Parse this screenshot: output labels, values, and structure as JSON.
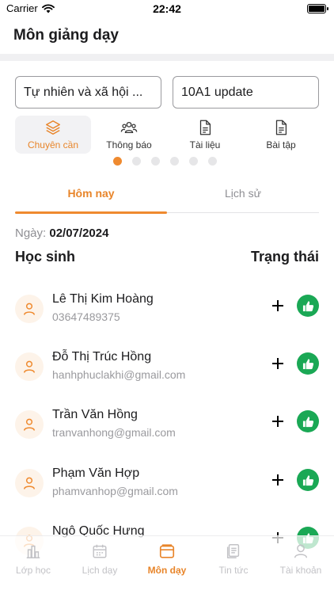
{
  "status_bar": {
    "carrier": "Carrier",
    "time": "22:42"
  },
  "header": {
    "title": "Môn giảng dạy"
  },
  "filters": {
    "subject": "Tự nhiên và xã hội ...",
    "class": "10A1 update"
  },
  "features": [
    {
      "label": "Chuyên cần",
      "icon": "layers-icon",
      "active": true
    },
    {
      "label": "Thông báo",
      "icon": "group-icon",
      "active": false
    },
    {
      "label": "Tài liệu",
      "icon": "document-icon",
      "active": false
    },
    {
      "label": "Bài tập",
      "icon": "document-icon",
      "active": false
    }
  ],
  "carousel": {
    "page_count": 6,
    "active_page": 1
  },
  "tabs": {
    "today": "Hôm nay",
    "history": "Lịch sử",
    "selected": "today"
  },
  "date": {
    "label": "Ngày:",
    "value": "02/07/2024"
  },
  "columns": {
    "student": "Học sinh",
    "status": "Trạng thái"
  },
  "students": [
    {
      "name": "Lê Thị Kim Hoàng",
      "sub": "03647489375"
    },
    {
      "name": "Đỗ Thị Trúc Hồng",
      "sub": "hanhphuclakhi@gmail.com"
    },
    {
      "name": "Trần Văn Hồng",
      "sub": "tranvanhong@gmail.com"
    },
    {
      "name": "Phạm Văn Hợp",
      "sub": "phamvanhop@gmail.com"
    },
    {
      "name": "Ngô Quốc Hưng",
      "sub": ""
    }
  ],
  "bottom_nav": [
    {
      "label": "Lớp học",
      "icon": "chart-icon",
      "active": false
    },
    {
      "label": "Lịch dạy",
      "icon": "calendar-icon",
      "active": false
    },
    {
      "label": "Môn dạy",
      "icon": "folder-icon",
      "active": true
    },
    {
      "label": "Tin tức",
      "icon": "news-icon",
      "active": false
    },
    {
      "label": "Tài khoản",
      "icon": "account-icon",
      "active": false
    }
  ],
  "colors": {
    "accent": "#ef8a2f",
    "success": "#1aa855",
    "muted": "#8e8e93"
  }
}
